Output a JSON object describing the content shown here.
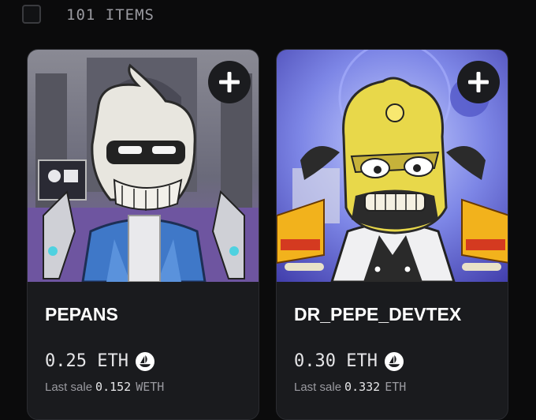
{
  "header": {
    "item_count": "101 ITEMS"
  },
  "cards": [
    {
      "name": "PEPANS",
      "price": "0.25 ETH",
      "last_sale_label": "Last sale",
      "last_sale_value": "0.152",
      "last_sale_currency": "WETH",
      "image_subject": "skull-character-blue-hoodie"
    },
    {
      "name": "DR_PEPE_DEVTEX",
      "price": "0.30 ETH",
      "last_sale_label": "Last sale",
      "last_sale_value": "0.332",
      "last_sale_currency": "ETH",
      "image_subject": "yellow-frog-mad-scientist"
    }
  ],
  "icons": {
    "add": "plus-icon",
    "marketplace": "opensea-ship-icon",
    "select": "checkbox-icon"
  },
  "colors": {
    "background": "#0b0b0c",
    "card": "#1a1b1e",
    "muted_text": "#9a9aa0"
  }
}
